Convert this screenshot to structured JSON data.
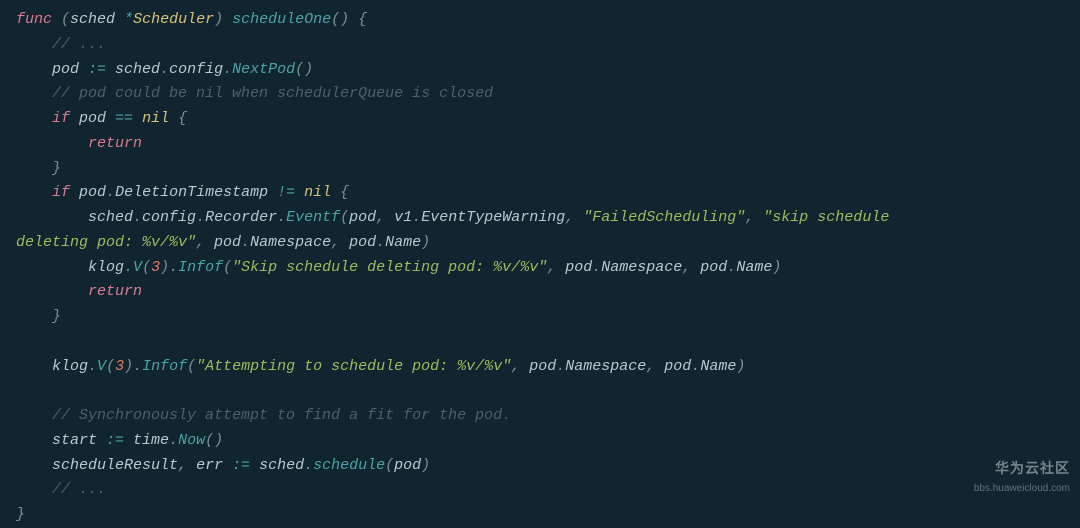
{
  "code": {
    "l1": {
      "kw1": "func",
      "p1": " (",
      "id1": "sched ",
      "op1": "*",
      "ty1": "Scheduler",
      "p2": ") ",
      "fn1": "scheduleOne",
      "p3": "() {"
    },
    "l2": {
      "c": "// ..."
    },
    "l3": {
      "id1": "pod ",
      "op1": ":=",
      "id2": " sched",
      "p1": ".",
      "id3": "config",
      "p2": ".",
      "fn1": "NextPod",
      "p3": "()"
    },
    "l4": {
      "c": "// pod could be nil when schedulerQueue is closed"
    },
    "l5": {
      "kw1": "if",
      "id1": " pod ",
      "op1": "==",
      "sp": " ",
      "ty1": "nil",
      "p1": " {"
    },
    "l6": {
      "kw1": "return"
    },
    "l7": {
      "p1": "}"
    },
    "l8": {
      "kw1": "if",
      "id1": " pod",
      "p1": ".",
      "id2": "DeletionTimestamp ",
      "op1": "!=",
      "sp": " ",
      "ty1": "nil",
      "p2": " {"
    },
    "l9": {
      "id1": "sched",
      "p1": ".",
      "id2": "config",
      "p2": ".",
      "id3": "Recorder",
      "p3": ".",
      "fn1": "Eventf",
      "p4": "(",
      "id4": "pod",
      "p5": ", ",
      "id5": "v1",
      "p6": ".",
      "id6": "EventTypeWarning",
      "p7": ", ",
      "s1": "\"FailedScheduling\"",
      "p8": ", ",
      "s2": "\"skip schedule"
    },
    "l10": {
      "s1": "deleting pod: %v/%v\"",
      "p1": ", ",
      "id1": "pod",
      "p2": ".",
      "id2": "Namespace",
      "p3": ", ",
      "id3": "pod",
      "p4": ".",
      "id4": "Name",
      "p5": ")"
    },
    "l11": {
      "id1": "klog",
      "p1": ".",
      "fn1": "V",
      "p2": "(",
      "n1": "3",
      "p3": ").",
      "fn2": "Infof",
      "p4": "(",
      "s1": "\"Skip schedule deleting pod: %v/%v\"",
      "p5": ", ",
      "id2": "pod",
      "p6": ".",
      "id3": "Namespace",
      "p7": ", ",
      "id4": "pod",
      "p8": ".",
      "id5": "Name",
      "p9": ")"
    },
    "l12": {
      "kw1": "return"
    },
    "l13": {
      "p1": "}"
    },
    "l14": {
      "id1": "klog",
      "p1": ".",
      "fn1": "V",
      "p2": "(",
      "n1": "3",
      "p3": ").",
      "fn2": "Infof",
      "p4": "(",
      "s1": "\"Attempting to schedule pod: %v/%v\"",
      "p5": ", ",
      "id2": "pod",
      "p6": ".",
      "id3": "Namespace",
      "p7": ", ",
      "id4": "pod",
      "p8": ".",
      "id5": "Name",
      "p9": ")"
    },
    "l15": {
      "c": "// Synchronously attempt to find a fit for the pod."
    },
    "l16": {
      "id1": "start ",
      "op1": ":=",
      "id2": " time",
      "p1": ".",
      "fn1": "Now",
      "p2": "()"
    },
    "l17": {
      "id1": "scheduleResult",
      "p1": ", ",
      "id2": "err ",
      "op1": ":=",
      "id3": " sched",
      "p2": ".",
      "fn1": "schedule",
      "p3": "(",
      "id4": "pod",
      "p4": ")"
    },
    "l18": {
      "c": "// ..."
    },
    "l19": {
      "p1": "}"
    }
  },
  "watermark": {
    "big": "华为云社区",
    "small": "bbs.huaweicloud.com"
  }
}
